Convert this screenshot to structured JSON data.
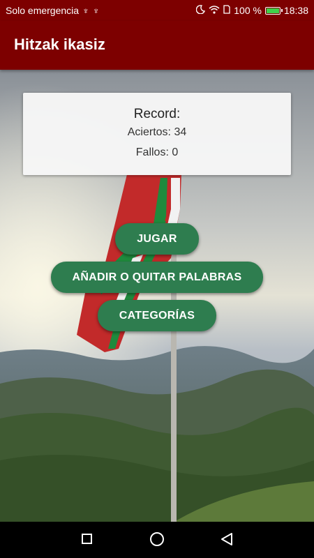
{
  "status_bar": {
    "carrier": "Solo emergencia",
    "battery_percent": "100 %",
    "time": "18:38",
    "icons": [
      "usb-icon",
      "usb-icon",
      "moon-icon",
      "wifi-icon",
      "sim-icon",
      "battery-icon"
    ]
  },
  "app_bar": {
    "title": "Hitzak ikasiz",
    "color": "#7d0000"
  },
  "record": {
    "title": "Record:",
    "hits_label": "Aciertos: 34",
    "misses_label": "Fallos: 0"
  },
  "buttons": {
    "play": "JUGAR",
    "edit_words": "AÑADIR O QUITAR PALABRAS",
    "categories": "CATEGORÍAS",
    "color": "#2e7d4f"
  },
  "nav_bar": {
    "icons": [
      "recent-apps-icon",
      "home-icon",
      "back-icon"
    ]
  }
}
